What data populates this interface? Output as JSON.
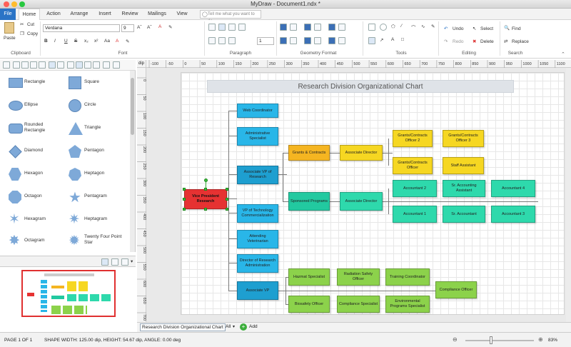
{
  "window": {
    "title": "MyDraw - Document1.ndx *"
  },
  "tabs": [
    "File",
    "Home",
    "Action",
    "Arrange",
    "Insert",
    "Review",
    "Mailings",
    "View"
  ],
  "tellme": {
    "placeholder": "Tell me what you want to do"
  },
  "ribbon": {
    "clipboard": {
      "label": "Clipboard",
      "paste": "Paste",
      "cut": "Cut",
      "copy": "Copy"
    },
    "font": {
      "label": "Font",
      "family": "Verdana",
      "size": "9"
    },
    "paragraph": {
      "label": "Paragraph",
      "spacing": "1"
    },
    "geometry": {
      "label": "Geometry Format"
    },
    "tools": {
      "label": "Tools"
    },
    "editing": {
      "label": "Editing",
      "undo": "Undo",
      "redo": "Redo",
      "select": "Select",
      "delete": "Delete"
    },
    "search": {
      "label": "Search",
      "find": "Find",
      "replace": "Replace"
    }
  },
  "ruler": {
    "unit": "dip",
    "top": [
      "-100",
      "-50",
      "0",
      "50",
      "100",
      "150",
      "200",
      "250",
      "300",
      "350",
      "400",
      "450",
      "500",
      "550",
      "600",
      "650",
      "700",
      "750",
      "800",
      "850",
      "900",
      "950",
      "1000",
      "1050",
      "1100"
    ],
    "left": [
      "0",
      "50",
      "100",
      "150",
      "200",
      "250",
      "300",
      "350",
      "400",
      "450",
      "500",
      "550",
      "600",
      "650",
      "700"
    ]
  },
  "shapes": [
    {
      "a": "Rectangle",
      "b": "Square"
    },
    {
      "a": "Ellipse",
      "b": "Circle"
    },
    {
      "a": "Rounded Rectangle",
      "b": "Triangle"
    },
    {
      "a": "Diamond",
      "b": "Pentagon"
    },
    {
      "a": "Hexagon",
      "b": "Heptagon"
    },
    {
      "a": "Octagon",
      "b": "Pentagram"
    },
    {
      "a": "Hexagram",
      "b": "Heptagram"
    },
    {
      "a": "Octagram",
      "b": "Twenty Four Point Star"
    }
  ],
  "chart": {
    "title": "Research Division Organizational Chart",
    "nodes": {
      "vp": "Vice President Research",
      "web": "Web Coordinator",
      "admin": "Administrative Specialist",
      "avp": "Associate VP of Research",
      "vptc": "VP of Technology Commercialization",
      "vet": "Attending Veterinarian",
      "dra": "Director of Research Administration",
      "assocvp": "Associate VP",
      "grants": "Grants & Contracts",
      "ad1": "Associate Director",
      "gco2": "Grants/Contracts Officer 2",
      "gco3": "Grants/Contracts Officer 3",
      "gco": "Grants/Contracts Officer",
      "staff": "Staff Assistant",
      "sponsored": "Sponsored Programs",
      "ad2": "Associate Director",
      "acc2": "Accountant 2",
      "sracc": "Sr. Accounting Assistant",
      "acc4": "Accountant 4",
      "acc1": "Accountant 1",
      "sraccnt": "Sr. Accountant",
      "acc3": "Accountant 3",
      "hazmat": "Hazmat Specialist",
      "radiation": "Radiation Safety Officer",
      "training": "Training Coordinator",
      "biosafety": "Biosafety Officer",
      "compliance": "Compliance Specialist",
      "env": "Environmental Programs Specialist",
      "co": "Compliance Officer"
    }
  },
  "sheetbar": {
    "tab": "Research Division Organizational Chart",
    "all": "All",
    "add": "Add"
  },
  "status": {
    "page": "PAGE 1 OF 1",
    "shape": "SHAPE WIDTH: 125.00 dip, HEIGHT: 54.67 dip, ANGLE: 0.00 deg",
    "zoom": "83%"
  }
}
